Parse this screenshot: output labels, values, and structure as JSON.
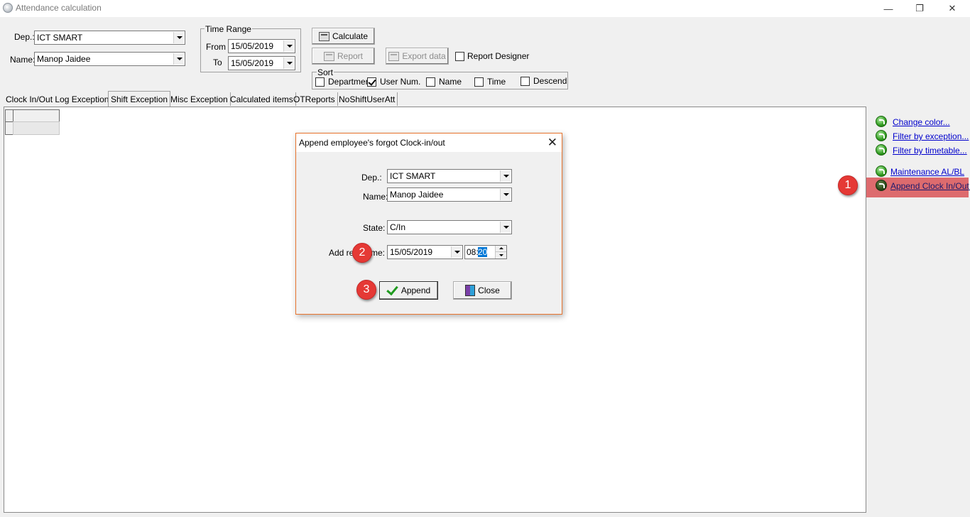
{
  "window": {
    "title": "Attendance calculation",
    "minimize_icon": "minimize-icon",
    "restore_icon": "restore-icon",
    "close_icon": "close-icon",
    "minimize_glyph": "—",
    "restore_glyph": "❐",
    "close_glyph": "✕"
  },
  "filters": {
    "dep_label": "Dep.:",
    "dep_value": "ICT SMART",
    "name_label": "Name:",
    "name_value": "Manop Jaidee",
    "time_range": {
      "title": "Time Range",
      "from_label": "From",
      "from_value": "15/05/2019",
      "to_label": "To",
      "to_value": "15/05/2019"
    }
  },
  "toolbar": {
    "calculate_label": "Calculate",
    "report_label": "Report",
    "export_label": "Export data",
    "report_designer_label": "Report Designer",
    "report_designer_checked": false
  },
  "sort": {
    "title": "Sort",
    "options": [
      {
        "label": "Departmer",
        "checked": false
      },
      {
        "label": "User Num.",
        "checked": true
      },
      {
        "label": "Name",
        "checked": false
      },
      {
        "label": "Time",
        "checked": false
      },
      {
        "label": "Descend",
        "checked": false
      }
    ]
  },
  "tabs": [
    {
      "label": "Clock In/Out Log Exceptions",
      "active": false
    },
    {
      "label": "Shift Exception",
      "active": true
    },
    {
      "label": "Misc Exception",
      "active": false
    },
    {
      "label": "Calculated items",
      "active": false
    },
    {
      "label": "OTReports",
      "active": false
    },
    {
      "label": "NoShiftUserAtt",
      "active": false
    }
  ],
  "side_links": [
    {
      "label": "Change color...",
      "icon": "green-arrow-icon"
    },
    {
      "label": "Filter by exception...",
      "icon": "green-arrow-icon"
    },
    {
      "label": "Filter by timetable...",
      "icon": "green-arrow-icon"
    },
    {
      "label": "Maintenance AL/BL",
      "icon": "green-arrow-icon"
    },
    {
      "label": "Append Clock In/Out l",
      "icon": "green-arrow-icon",
      "highlighted": true
    }
  ],
  "highlight_color": "#dd6b6e",
  "markers": [
    "1",
    "2",
    "3"
  ],
  "dialog": {
    "title": "Append employee's forgot Clock-in/out",
    "dep_label": "Dep.:",
    "dep_value": "ICT SMART",
    "name_label": "Name:",
    "name_value": "Manop Jaidee",
    "state_label": "State:",
    "state_value": "C/In",
    "add_time_label_left": "Add re",
    "add_time_label_right": "me:",
    "date_value": "15/05/2019",
    "time_hour": "08:",
    "time_minute": "20",
    "append_label": "Append",
    "close_label": "Close",
    "close_glyph": "✕"
  }
}
